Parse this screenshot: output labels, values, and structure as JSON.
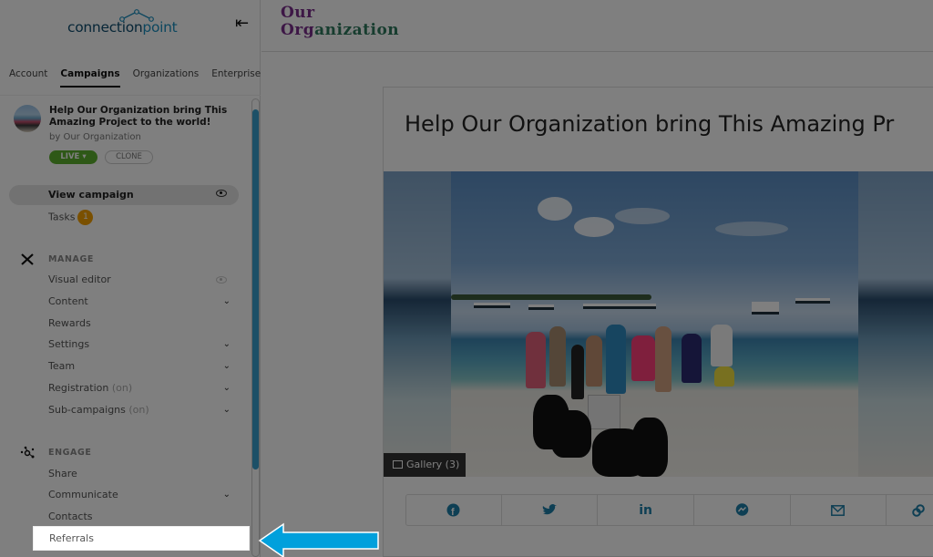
{
  "sidebar": {
    "logo": {
      "part1": "connection",
      "part2": "point"
    },
    "collapse_icon": "collapse-left-icon",
    "tabs": [
      {
        "label": "Account",
        "active": false
      },
      {
        "label": "Campaigns",
        "active": true
      },
      {
        "label": "Organizations",
        "active": false
      },
      {
        "label": "Enterprise",
        "active": false
      }
    ],
    "campaign": {
      "title": "Help Our Organization bring This Amazing Project to the world!",
      "by": "by Our Organization",
      "status_label": "LIVE ▾",
      "clone_label": "CLONE"
    },
    "view_campaign": "View campaign",
    "tasks": {
      "label": "Tasks",
      "count": "1"
    },
    "sections": [
      {
        "title": "MANAGE",
        "icon": "tools-icon",
        "items": [
          {
            "label": "Visual editor",
            "suffix": "",
            "chevron": false,
            "eye": true
          },
          {
            "label": "Content",
            "suffix": "",
            "chevron": true
          },
          {
            "label": "Rewards",
            "suffix": "",
            "chevron": false
          },
          {
            "label": "Settings",
            "suffix": "",
            "chevron": true
          },
          {
            "label": "Team",
            "suffix": "",
            "chevron": true
          },
          {
            "label": "Registration",
            "suffix": "(on)",
            "chevron": true
          },
          {
            "label": "Sub-campaigns",
            "suffix": "(on)",
            "chevron": true
          }
        ]
      },
      {
        "title": "ENGAGE",
        "icon": "network-icon",
        "items": [
          {
            "label": "Share",
            "suffix": "",
            "chevron": false
          },
          {
            "label": "Communicate",
            "suffix": "",
            "chevron": true
          },
          {
            "label": "Contacts",
            "suffix": "",
            "chevron": false
          },
          {
            "label": "Referrals",
            "suffix": "",
            "chevron": false,
            "highlighted": true
          }
        ]
      }
    ]
  },
  "main": {
    "org_logo": {
      "line1": "Our",
      "line2a": "Org",
      "line2b": "anization"
    },
    "campaign_title": "Help Our Organization bring This Amazing Pr",
    "gallery_label": "Gallery (3)",
    "share_buttons": [
      {
        "name": "facebook",
        "glyph": "f"
      },
      {
        "name": "twitter",
        "glyph": "🐦"
      },
      {
        "name": "linkedin",
        "glyph": "in"
      },
      {
        "name": "messenger",
        "glyph": "ϟ"
      },
      {
        "name": "email",
        "glyph": "✉"
      },
      {
        "name": "link",
        "glyph": "🔗"
      }
    ]
  },
  "overlay": {
    "highlight_target": "Referrals",
    "arrow_color": "#00a0dc"
  },
  "colors": {
    "brand_dark": "#0f4c6e",
    "brand_light": "#1b8fbf",
    "live_green": "#5db12f",
    "badge_orange": "#f5a000",
    "share_blue": "#1d7fa8"
  }
}
